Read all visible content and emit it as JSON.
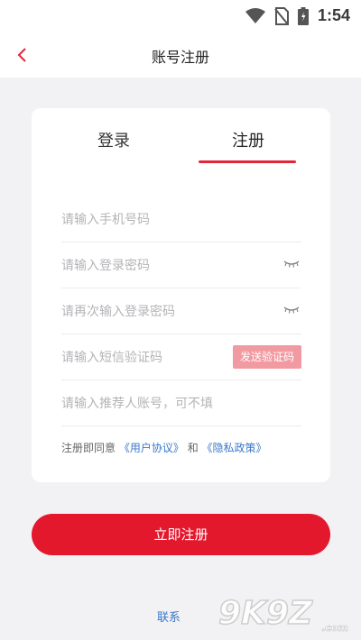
{
  "status_bar": {
    "time": "1:54"
  },
  "header": {
    "title": "账号注册"
  },
  "tabs": {
    "login": "登录",
    "register": "注册"
  },
  "fields": {
    "phone_placeholder": "请输入手机号码",
    "password_placeholder": "请输入登录密码",
    "confirm_password_placeholder": "请再次输入登录密码",
    "sms_code_placeholder": "请输入短信验证码",
    "sms_button": "发送验证码",
    "referrer_placeholder": "请输入推荐人账号，可不填"
  },
  "agreement": {
    "prefix": "注册即同意",
    "user_agreement": "《用户协议》",
    "and": "和",
    "privacy_policy": "《隐私政策》"
  },
  "submit_label": "立即注册",
  "contact_label": "联系",
  "watermark": "9K9Z.com",
  "colors": {
    "accent": "#e3182d",
    "link": "#3b78c9",
    "sms_button": "#f29aa2"
  }
}
